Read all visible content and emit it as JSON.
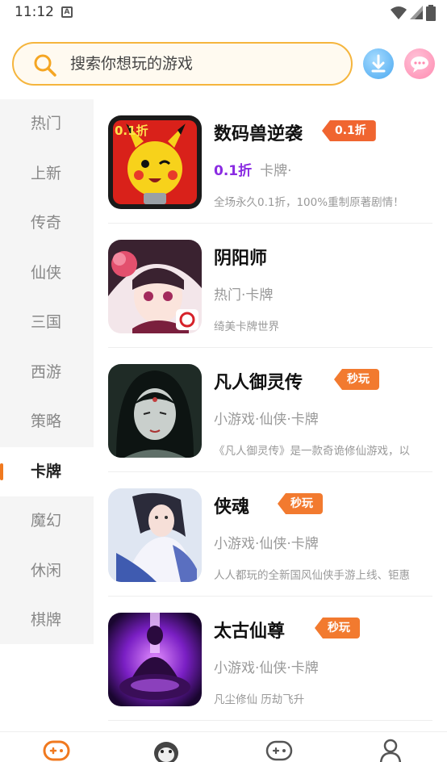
{
  "status_bar": {
    "time": "11:12",
    "notif_glyph": "A"
  },
  "search": {
    "placeholder": "搜索你想玩的游戏"
  },
  "header_icons": [
    "download-icon",
    "message-icon"
  ],
  "sidebar": {
    "items": [
      {
        "label": "热门"
      },
      {
        "label": "上新"
      },
      {
        "label": "传奇"
      },
      {
        "label": "仙侠"
      },
      {
        "label": "三国"
      },
      {
        "label": "西游"
      },
      {
        "label": "策略"
      },
      {
        "label": "卡牌",
        "active": true
      },
      {
        "label": "魔幻"
      },
      {
        "label": "休闲"
      },
      {
        "label": "棋牌"
      }
    ]
  },
  "games": [
    {
      "name": "数码兽逆袭",
      "badge": "0.1折",
      "discount": "0.1折",
      "tags": "卡牌·",
      "desc": "全场永久0.1折，100%重制原著剧情！"
    },
    {
      "name": "阴阳师",
      "badge": "",
      "tags": "热门·卡牌",
      "desc": "绮美卡牌世界"
    },
    {
      "name": "凡人御灵传",
      "badge": "秒玩",
      "tags": "小游戏·仙侠·卡牌",
      "desc": "《凡人御灵传》是一款奇诡修仙游戏，以"
    },
    {
      "name": "侠魂",
      "badge": "秒玩",
      "tags": "小游戏·仙侠·卡牌",
      "desc": "人人都玩的全新国风仙侠手游上线、钜惠"
    },
    {
      "name": "太古仙尊",
      "badge": "秒玩",
      "tags": "小游戏·仙侠·卡牌",
      "desc": "凡尘修仙 历劫飞升"
    }
  ],
  "bottom_nav": [
    "gamepad-icon",
    "mascot-icon",
    "game-controller-icon",
    "profile-icon"
  ],
  "colors": {
    "accent": "#f0791f",
    "search_border": "#f5b53d",
    "discount_text": "#8a2be2",
    "badge": "#f06530"
  }
}
